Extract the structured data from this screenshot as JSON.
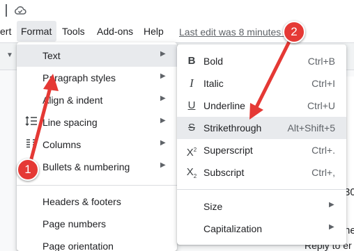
{
  "menubar": {
    "items": [
      "ert",
      "Format",
      "Tools",
      "Add-ons",
      "Help"
    ],
    "last_edit": "Last edit was 8 minutes ago"
  },
  "format_menu": {
    "items": [
      {
        "label": "Text",
        "has_submenu": true,
        "icon": ""
      },
      {
        "label": "Paragraph styles",
        "has_submenu": true,
        "icon": ""
      },
      {
        "label": "Align & indent",
        "has_submenu": true,
        "icon": ""
      },
      {
        "label": "Line spacing",
        "has_submenu": true,
        "icon": "line-spacing-icon"
      },
      {
        "label": "Columns",
        "has_submenu": true,
        "icon": "columns-icon"
      },
      {
        "label": "Bullets & numbering",
        "has_submenu": true,
        "icon": ""
      },
      {
        "label": "Headers & footers",
        "has_submenu": false,
        "icon": ""
      },
      {
        "label": "Page numbers",
        "has_submenu": false,
        "icon": ""
      },
      {
        "label": "Page orientation",
        "has_submenu": false,
        "icon": ""
      }
    ]
  },
  "text_submenu": {
    "items": [
      {
        "label": "Bold",
        "shortcut": "Ctrl+B",
        "icon": "bold-icon"
      },
      {
        "label": "Italic",
        "shortcut": "Ctrl+I",
        "icon": "italic-icon"
      },
      {
        "label": "Underline",
        "shortcut": "Ctrl+U",
        "icon": "underline-icon"
      },
      {
        "label": "Strikethrough",
        "shortcut": "Alt+Shift+5",
        "icon": "strikethrough-icon"
      },
      {
        "label": "Superscript",
        "shortcut": "Ctrl+.",
        "icon": "superscript-icon"
      },
      {
        "label": "Subscript",
        "shortcut": "Ctrl+,",
        "icon": "subscript-icon"
      },
      {
        "label": "Size",
        "shortcut": "",
        "icon": ""
      },
      {
        "label": "Capitalization",
        "shortcut": "",
        "icon": ""
      }
    ]
  },
  "callouts": [
    "1",
    "2"
  ],
  "doc_fragments": [
    "30",
    "he",
    "Reply to er"
  ],
  "colors": {
    "callout": "#e53935",
    "highlight": "#e8eaed"
  }
}
